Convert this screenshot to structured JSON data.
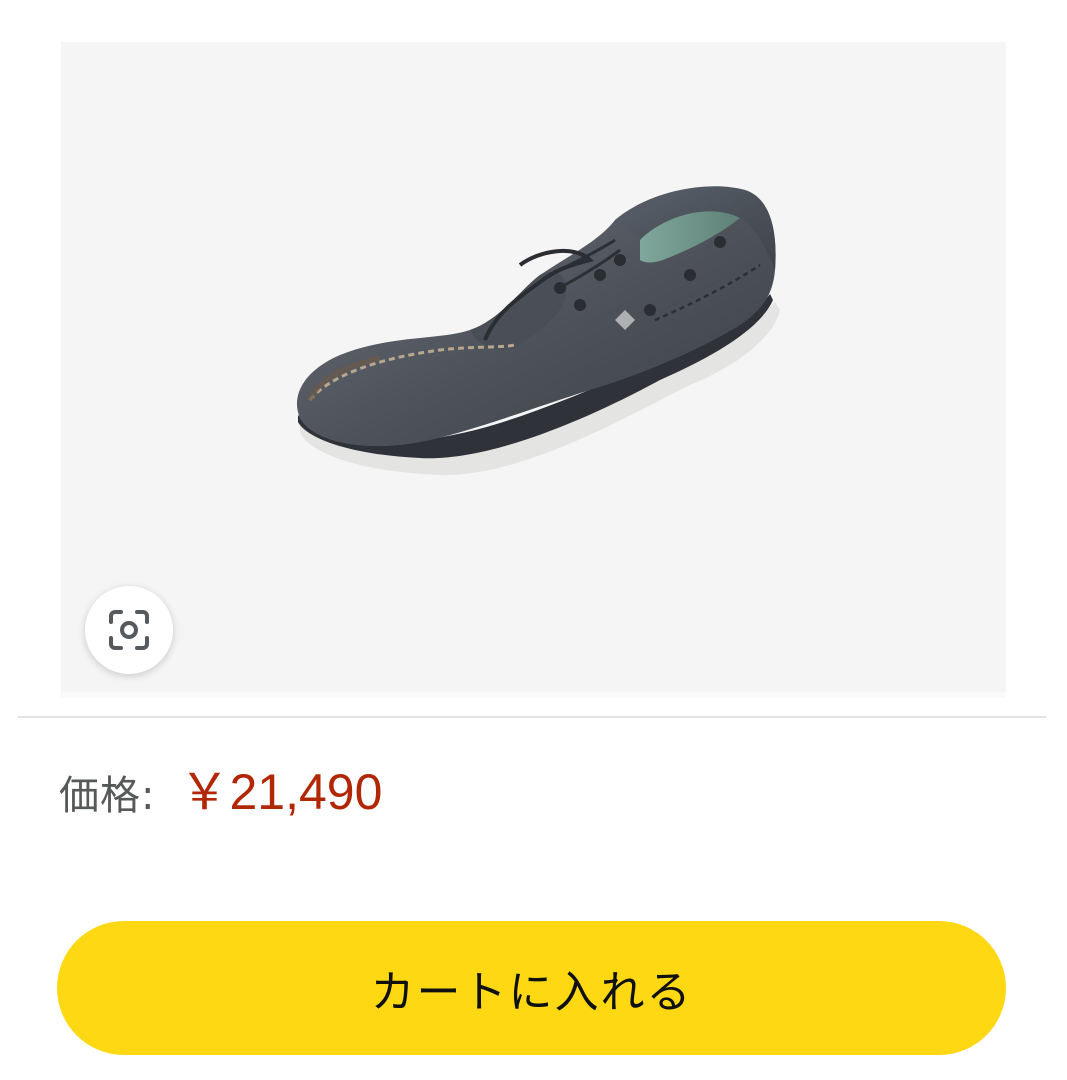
{
  "product": {
    "image_alt": "グレーのデッキシューズ",
    "lens_icon": "camera-scan-icon"
  },
  "price": {
    "label": "価格:",
    "value": "￥21,490",
    "color": "#b12704"
  },
  "cart": {
    "button_label": "カートに入れる",
    "button_color": "#ffd814"
  }
}
